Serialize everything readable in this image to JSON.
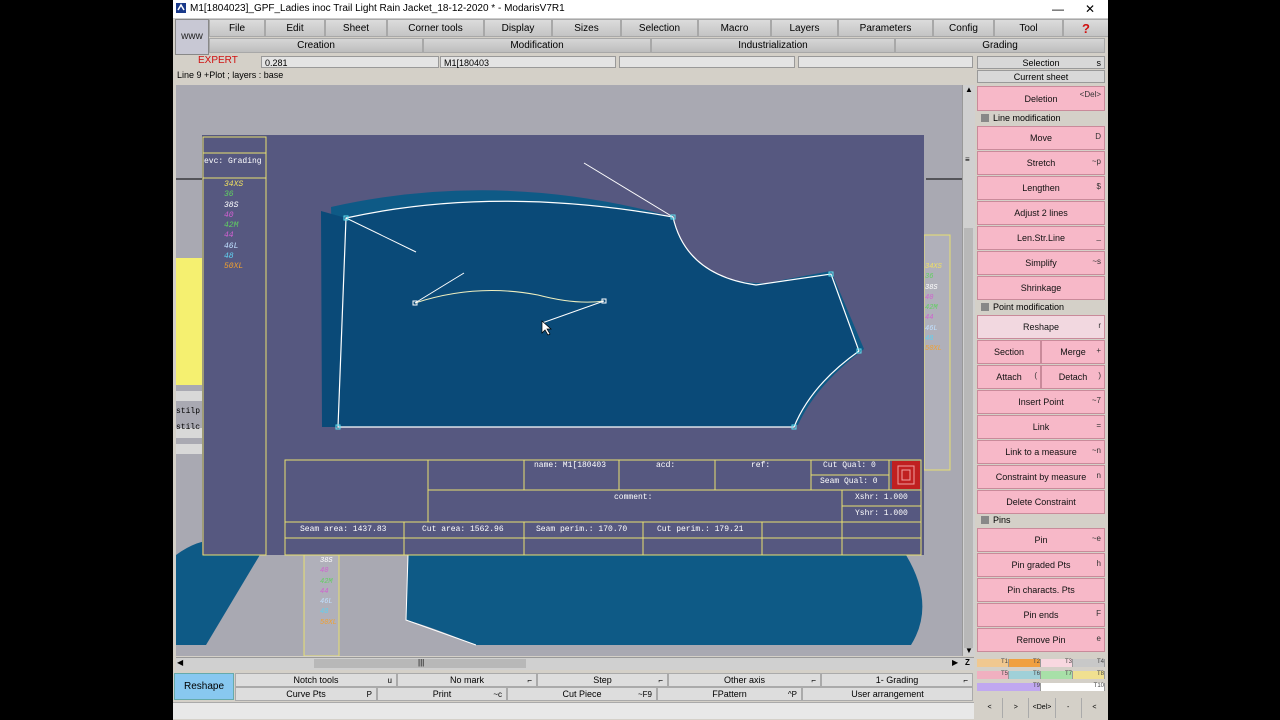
{
  "window": {
    "title": "M1[1804023]_GPF_Ladies inoc Trail Light Rain Jacket_18-12-2020 *  - ModarisV7R1",
    "minimize": "—",
    "close": "✕"
  },
  "www_label": "www",
  "menus": [
    "File",
    "Edit",
    "Sheet",
    "Corner tools",
    "Display",
    "Sizes",
    "Selection",
    "Macro",
    "Layers",
    "Parameters",
    "Config",
    "Tool",
    "?"
  ],
  "submenus": [
    "Creation",
    "Modification",
    "Industrialization",
    "Grading"
  ],
  "expert_label": "EXPERT",
  "fields": {
    "value1": "0.281",
    "value2": "M1[180403",
    "value3": "",
    "value4": ""
  },
  "status_line": "Line 9 +Plot   ;   layers :  base",
  "right_panel": {
    "selection": "Selection",
    "selection_shortcut": "s",
    "current_sheet": "Current sheet",
    "deletion": {
      "label": "Deletion",
      "shortcut": "<Del>"
    },
    "line_modification": "Line modification",
    "line_buttons": [
      {
        "label": "Move",
        "shortcut": "D"
      },
      {
        "label": "Stretch",
        "shortcut": "~p"
      },
      {
        "label": "Lengthen",
        "shortcut": "$"
      },
      {
        "label": "Adjust 2 lines",
        "shortcut": ""
      },
      {
        "label": "Len.Str.Line",
        "shortcut": "_"
      },
      {
        "label": "Simplify",
        "shortcut": "~s"
      },
      {
        "label": "Shrinkage",
        "shortcut": ""
      }
    ],
    "point_modification": "Point modification",
    "reshape": {
      "label": "Reshape",
      "shortcut": "r"
    },
    "section": {
      "label": "Section"
    },
    "merge": {
      "label": "Merge",
      "shortcut": "+"
    },
    "attach": {
      "label": "Attach",
      "shortcut": "("
    },
    "detach": {
      "label": "Detach",
      "shortcut": ")"
    },
    "point_buttons": [
      {
        "label": "Insert Point",
        "shortcut": "~7"
      },
      {
        "label": "Link",
        "shortcut": "="
      },
      {
        "label": "Link to a measure",
        "shortcut": "~n"
      },
      {
        "label": "Constraint by measure",
        "shortcut": "n"
      },
      {
        "label": "Delete Constraint",
        "shortcut": ""
      }
    ],
    "pins": "Pins",
    "pin_buttons": [
      {
        "label": "Pin",
        "shortcut": "~e"
      },
      {
        "label": "Pin graded Pts",
        "shortcut": "h"
      },
      {
        "label": "Pin characts. Pts",
        "shortcut": ""
      },
      {
        "label": "Pin ends",
        "shortcut": "F"
      },
      {
        "label": "Remove Pin",
        "shortcut": "e"
      }
    ]
  },
  "swatches": [
    [
      {
        "label": "T1",
        "color": "#f0c890"
      },
      {
        "label": "T2",
        "color": "#f0a040"
      },
      {
        "label": "T3",
        "color": "#f8d8e0"
      },
      {
        "label": "T4",
        "color": "#c8c8c8"
      }
    ],
    [
      {
        "label": "T5",
        "color": "#f0b0c0"
      },
      {
        "label": "T6",
        "color": "#a0d0d8"
      },
      {
        "label": "T7",
        "color": "#a8e0a8"
      },
      {
        "label": "T8",
        "color": "#f0e090"
      }
    ],
    [
      {
        "label": "T9",
        "color": "#c0a8f0"
      },
      {
        "label": "T10",
        "color": "#ffffff"
      }
    ]
  ],
  "bottom": {
    "reshape": "Reshape",
    "row1": [
      {
        "label": "Notch tools",
        "shortcut": "u"
      },
      {
        "label": "No mark",
        "shortcut": "⌐"
      },
      {
        "label": "Step",
        "shortcut": "⌐"
      },
      {
        "label": "Other axis",
        "shortcut": "⌐"
      },
      {
        "label": "1- Grading",
        "shortcut": "⌐"
      }
    ],
    "row2": [
      {
        "label": "Curve Pts",
        "shortcut": "P"
      },
      {
        "label": "Print",
        "shortcut": "~c"
      },
      {
        "label": "Cut Piece",
        "shortcut": "~F9"
      },
      {
        "label": "FPattern",
        "shortcut": "^P"
      },
      {
        "label": "User arrangement",
        "shortcut": ""
      }
    ],
    "nav_labels": [
      "<",
      ">",
      "<Del>",
      "-",
      "<"
    ]
  },
  "sheet": {
    "grading_header": "evc: Grading",
    "sizes": [
      {
        "label": "34XS",
        "color": "#f0e060"
      },
      {
        "label": "36",
        "color": "#60d060"
      },
      {
        "label": "38S",
        "color": "#ffffff"
      },
      {
        "label": "40",
        "color": "#d060d0"
      },
      {
        "label": "42M",
        "color": "#60d060"
      },
      {
        "label": "44",
        "color": "#d060d0"
      },
      {
        "label": "46L",
        "color": "#c0e0ff"
      },
      {
        "label": "48",
        "color": "#60d0f0"
      },
      {
        "label": "50XL",
        "color": "#f0a030"
      }
    ],
    "right_sizes": [
      "34XS",
      "36",
      "38S",
      "40",
      "42M",
      "44",
      "46L",
      "48",
      "50XL"
    ],
    "bottom_sizes": [
      "38S",
      "40",
      "42M",
      "44",
      "46L",
      "48",
      "50XL"
    ],
    "side_labels": [
      "stilp",
      "stilc"
    ],
    "info": {
      "name": "name: M1[180403",
      "acd": "acd:",
      "ref": "ref:",
      "cut_qual": "Cut Qual: 0",
      "seam_qual": "Seam Qual: 0",
      "comment": "comment:",
      "xshr": "Xshr: 1.000",
      "yshr": "Yshr: 1.000",
      "seam_area": "Seam area: 1437.83",
      "cut_area": "Cut area: 1562.96",
      "seam_perim": "Seam perim.: 170.70",
      "cut_perim": "Cut perim.: 179.21"
    }
  }
}
